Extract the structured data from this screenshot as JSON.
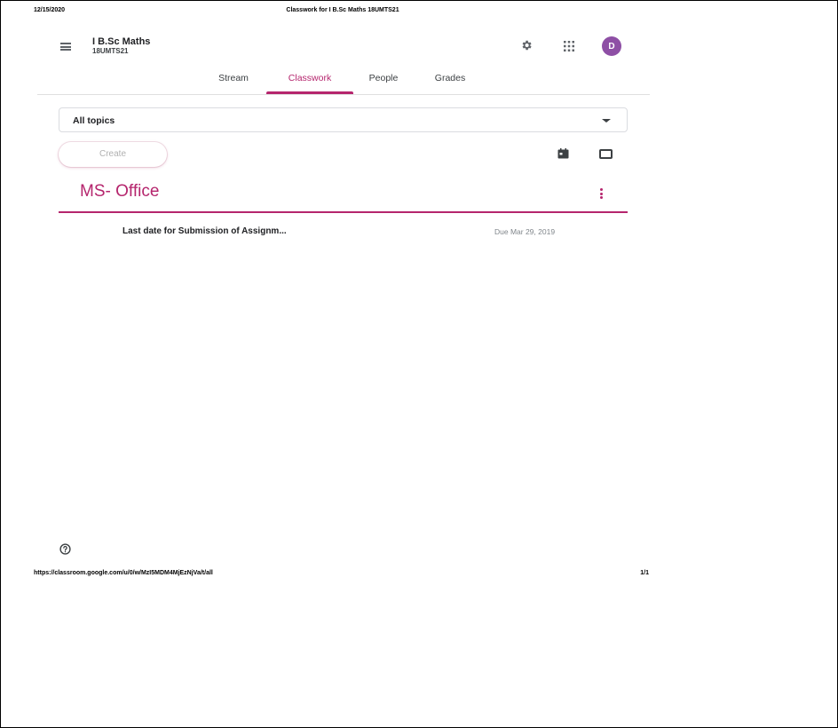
{
  "print": {
    "date": "12/15/2020",
    "title": "Classwork for I B.Sc Maths 18UMTS21",
    "url": "https://classroom.google.com/u/0/w/MzI5MDM4MjEzNjVa/t/all",
    "page": "1/1"
  },
  "header": {
    "class_name": "I B.Sc Maths",
    "class_section": "18UMTS21",
    "avatar_letter": "D",
    "icons": [
      "menu-icon",
      "gear-icon",
      "apps-icon"
    ]
  },
  "tabs": [
    {
      "label": "Stream",
      "active": false
    },
    {
      "label": "Classwork",
      "active": true
    },
    {
      "label": "People",
      "active": false
    },
    {
      "label": "Grades",
      "active": false
    }
  ],
  "filter": {
    "selected": "All topics"
  },
  "toolbar": {
    "create_label": "Create",
    "icons": [
      "calendar-icon",
      "folder-icon"
    ]
  },
  "topic": {
    "title": "MS- Office",
    "items": [
      {
        "title": "Last date for Submission of Assignm...",
        "due": "Due Mar 29, 2019"
      }
    ]
  },
  "colors": {
    "accent": "#b5256d",
    "avatar": "#8e4fa5"
  }
}
